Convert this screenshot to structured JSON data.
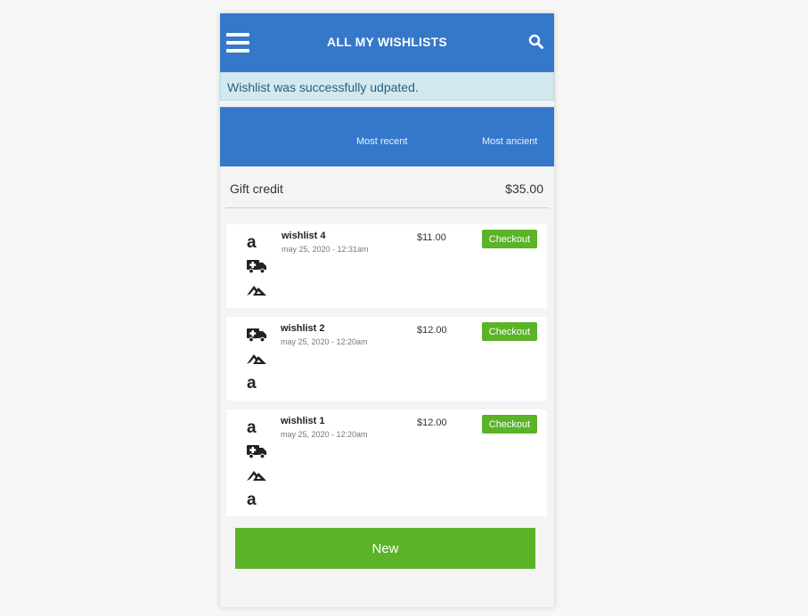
{
  "header": {
    "title": "ALL MY WISHLISTS"
  },
  "alert": {
    "message": "Wishlist was successfully udpated."
  },
  "sort": {
    "recent_label": "Most recent",
    "ancient_label": "Most ancient"
  },
  "gift_credit": {
    "label": "Gift credit",
    "value": "$35.00"
  },
  "wishlists": [
    {
      "name": "wishlist 4",
      "date": "may 25, 2020 - 12:31am",
      "price": "$11.00",
      "checkout_label": "Checkout",
      "icons": [
        "amazon-icon",
        "ambulance-icon",
        "shop-logo-icon"
      ]
    },
    {
      "name": "wishlist 2",
      "date": "may 25, 2020 - 12:20am",
      "price": "$12.00",
      "checkout_label": "Checkout",
      "icons": [
        "ambulance-icon",
        "shop-logo-icon",
        "amazon-icon"
      ]
    },
    {
      "name": "wishlist 1",
      "date": "may 25, 2020 - 12:20am",
      "price": "$12.00",
      "checkout_label": "Checkout",
      "icons": [
        "amazon-icon",
        "ambulance-icon",
        "shop-logo-icon",
        "amazon-icon"
      ]
    }
  ],
  "new_button": {
    "label": "New"
  },
  "colors": {
    "primary": "#3578c9",
    "success": "#5bb327",
    "alert_bg": "#d2e9f0"
  }
}
